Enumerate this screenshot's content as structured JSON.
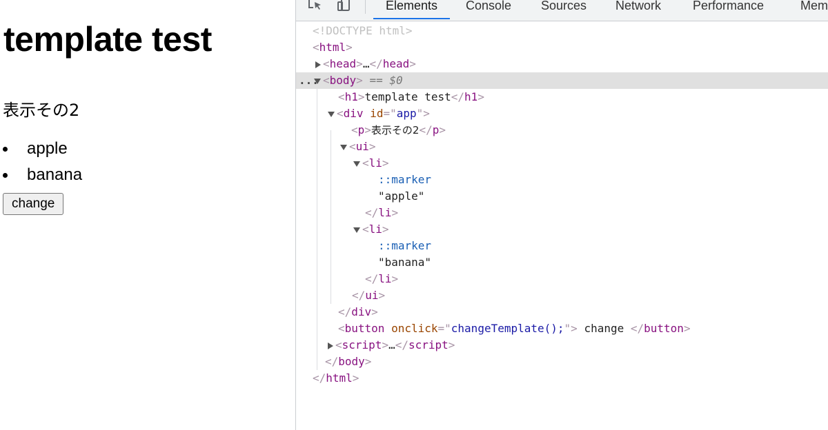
{
  "page": {
    "heading": "template test",
    "paragraph": "表示その2",
    "items": [
      "apple",
      "banana"
    ],
    "button_label": "change"
  },
  "devtools": {
    "tabs": [
      "Elements",
      "Console",
      "Sources",
      "Network",
      "Performance",
      "Memo"
    ],
    "active_tab": "Elements",
    "tree": {
      "doctype": "<!DOCTYPE html>",
      "html_tag": "html",
      "head_tag": "head",
      "collapsed_ellipsis": "…",
      "body_tag": "body",
      "selected_suffix": "== $0",
      "h1_tag": "h1",
      "h1_text": "template test",
      "div_tag": "div",
      "div_attr_name": "id",
      "div_attr_value": "app",
      "p_tag": "p",
      "p_text": "表示その2",
      "ui_tag": "ui",
      "li_tag": "li",
      "marker": "::marker",
      "li1_text": "\"apple\"",
      "li2_text": "\"banana\"",
      "button_tag": "button",
      "button_attr_name": "onclick",
      "button_attr_value": "changeTemplate();",
      "button_text": " change ",
      "script_tag": "script",
      "row_menu": "..."
    }
  }
}
